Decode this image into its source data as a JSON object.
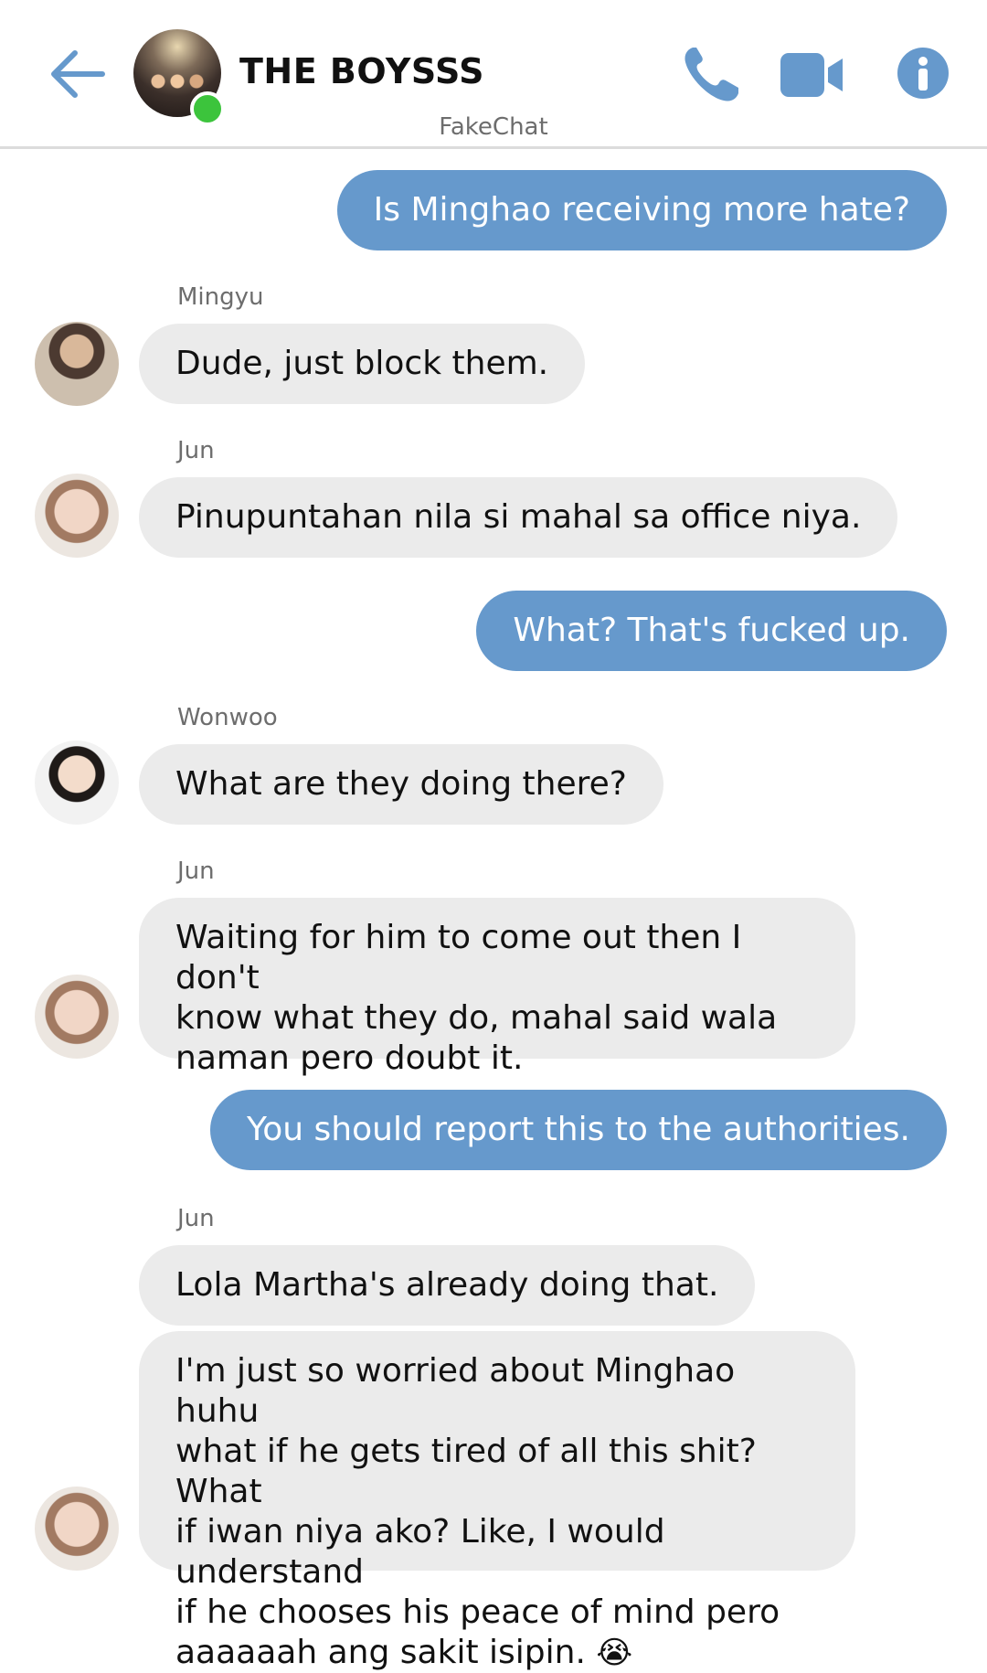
{
  "header": {
    "title": "THE BOYSSS",
    "subtitle": "FakeChat",
    "accent": "#6699cc",
    "online_color": "#3cc43c"
  },
  "messages": [
    {
      "side": "out",
      "text": "Is Minghao receiving more hate?"
    },
    {
      "side": "in",
      "sender": "Mingyu",
      "text": "Dude, just block them."
    },
    {
      "side": "in",
      "sender": "Jun",
      "text": "Pinupuntahan nila si mahal sa office niya."
    },
    {
      "side": "out",
      "text": "What? That's fucked up."
    },
    {
      "side": "in",
      "sender": "Wonwoo",
      "text": "What are they doing there?"
    },
    {
      "side": "in",
      "sender": "Jun",
      "lines": [
        "Waiting for him to come out then I don't",
        "know what they do, mahal said wala",
        "naman pero  doubt it."
      ]
    },
    {
      "side": "out",
      "text": "You should report this to the authorities."
    },
    {
      "side": "in",
      "sender": "Jun",
      "text": "Lola Martha's already doing that."
    },
    {
      "side": "in",
      "lines": [
        "I'm just so worried about Minghao huhu",
        "what if he gets tired of all this shit? What",
        "if iwan niya ako? Like, I would understand",
        "if he chooses his peace of mind pero",
        "aaaaaah ang sakit isipin."
      ],
      "emoji": "😭"
    }
  ]
}
